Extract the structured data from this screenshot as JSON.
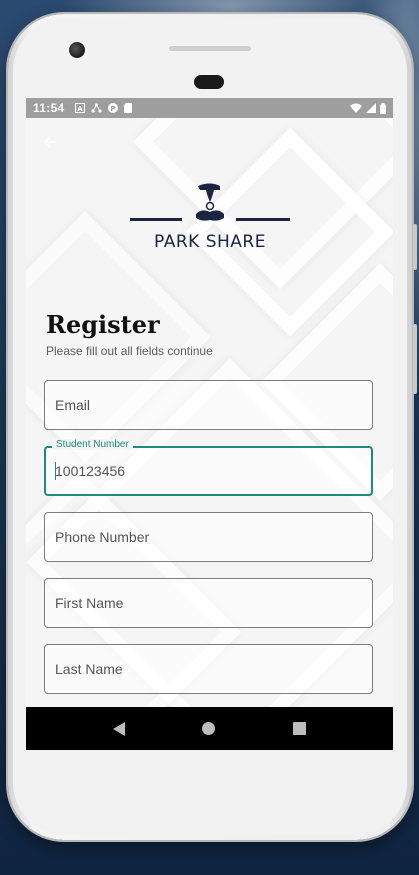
{
  "status_bar": {
    "time": "11:54",
    "icons_left": [
      "a-icon",
      "network-icon",
      "p-icon",
      "sd-card-icon"
    ],
    "icons_right": [
      "wifi-icon",
      "signal-icon",
      "battery-icon"
    ]
  },
  "app": {
    "brand": "PARK SHARE",
    "title": "Register",
    "subtitle": "Please fill out all fields continue"
  },
  "form": {
    "email": {
      "placeholder": "Email"
    },
    "student_number": {
      "label": "Student Number",
      "value": "100123456"
    },
    "phone": {
      "placeholder": "Phone Number"
    },
    "first_name": {
      "placeholder": "First Name"
    },
    "last_name": {
      "placeholder": "Last Name"
    }
  },
  "colors": {
    "accent": "#1f8a80",
    "brand_navy": "#1b2540",
    "nav_bar": "#000000",
    "status_bar": "#9e9e9e"
  }
}
